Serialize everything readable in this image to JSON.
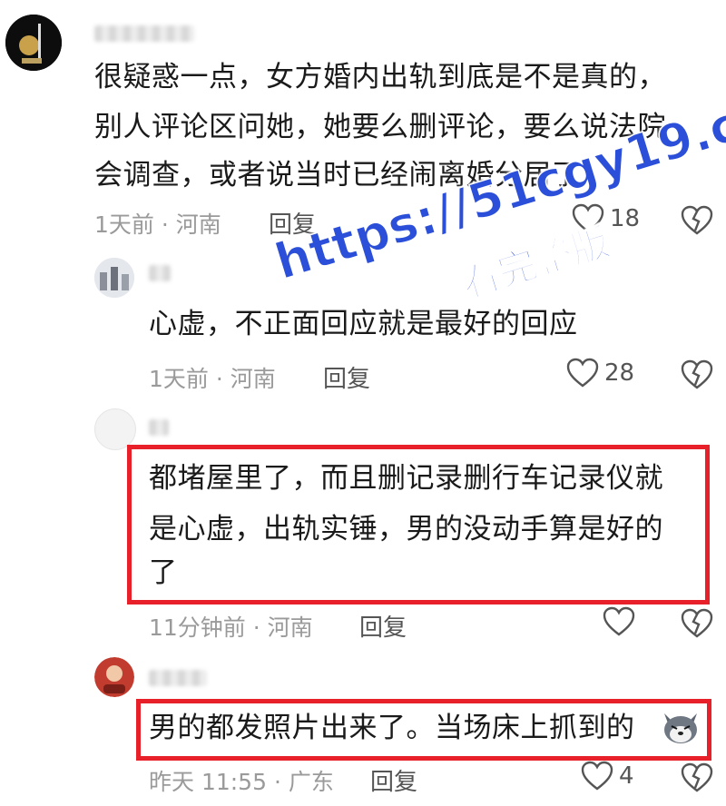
{
  "comments": [
    {
      "lines": [
        "很疑惑一点，女方婚内出轨到底是不是真的，",
        "别人评论区问她，她要么删评论，要么说法院",
        "会调查，或者说当时已经闹离婚分居了"
      ],
      "meta": "1天前 · 河南",
      "reply": "回复",
      "likes": "18"
    },
    {
      "lines": [
        "心虚，不正面回应就是最好的回应"
      ],
      "meta": "1天前 · 河南",
      "reply": "回复",
      "likes": "28"
    },
    {
      "lines": [
        "都堵屋里了，而且删记录删行车记录仪就",
        "是心虚，出轨实锤，男的没动手算是好的",
        "了"
      ],
      "meta": "11分钟前 · 河南",
      "reply": "回复",
      "likes": ""
    },
    {
      "lines": [
        "男的都发照片出来了。当场床上抓到的"
      ],
      "meta": "昨天 11:55 · 广东",
      "reply": "回复",
      "likes": "4"
    }
  ],
  "watermark": {
    "line1": "https://51cgy19.com",
    "line2": "看完整版"
  },
  "colors": {
    "highlight_border": "#e8202a",
    "watermark": "#2b4fd8",
    "meta_text": "#9a9a9a"
  },
  "icons": [
    "avatar",
    "heart-outline-icon",
    "broken-heart-icon",
    "husky-emoji-icon"
  ]
}
